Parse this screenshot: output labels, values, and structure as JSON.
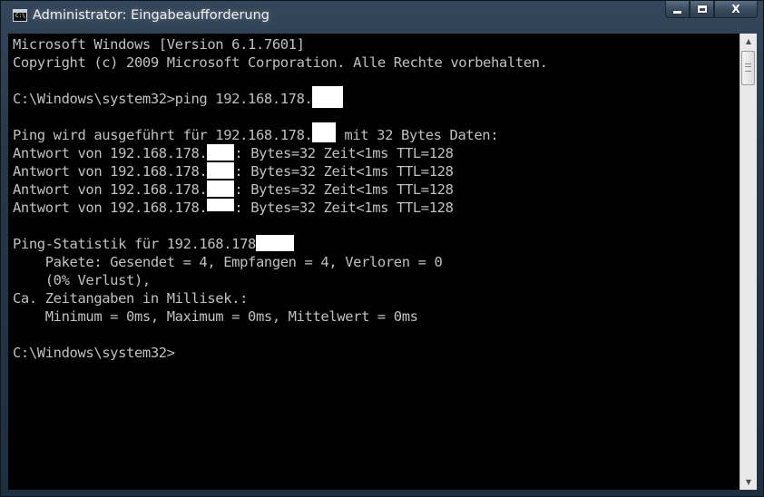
{
  "window": {
    "title": "Administrator: Eingabeaufforderung",
    "icon": "cmd-icon",
    "icon_text": "C:\\"
  },
  "caption_buttons": {
    "minimize": "minimize-icon",
    "maximize": "maximize-icon",
    "close": "close-icon",
    "close_label": "X"
  },
  "console": {
    "lines": [
      "Microsoft Windows [Version 6.1.7601]",
      "Copyright (c) 2009 Microsoft Corporation. Alle Rechte vorbehalten.",
      "",
      "C:\\Windows\\system32>ping 192.168.178.",
      "",
      "Ping wird ausgeführt für 192.168.178.",
      "Antwort von 192.168.178.",
      "Antwort von 192.168.178.",
      "Antwort von 192.168.178.",
      "Antwort von 192.168.178.",
      "",
      "Ping-Statistik für 192.168.178",
      "    Pakete: Gesendet = 4, Empfangen = 4, Verloren = 0",
      "    (0% Verlust),",
      "Ca. Zeitangaben in Millisek.:",
      "    Minimum = 0ms, Maximum = 0ms, Mittelwert = 0ms",
      "",
      "C:\\Windows\\system32>"
    ],
    "ping_data_suffix": " mit 32 Bytes Daten:",
    "reply_suffix": ": Bytes=32 Zeit<1ms TTL=128"
  },
  "colors": {
    "console_bg": "#000000",
    "console_fg": "#c0c0c0"
  }
}
